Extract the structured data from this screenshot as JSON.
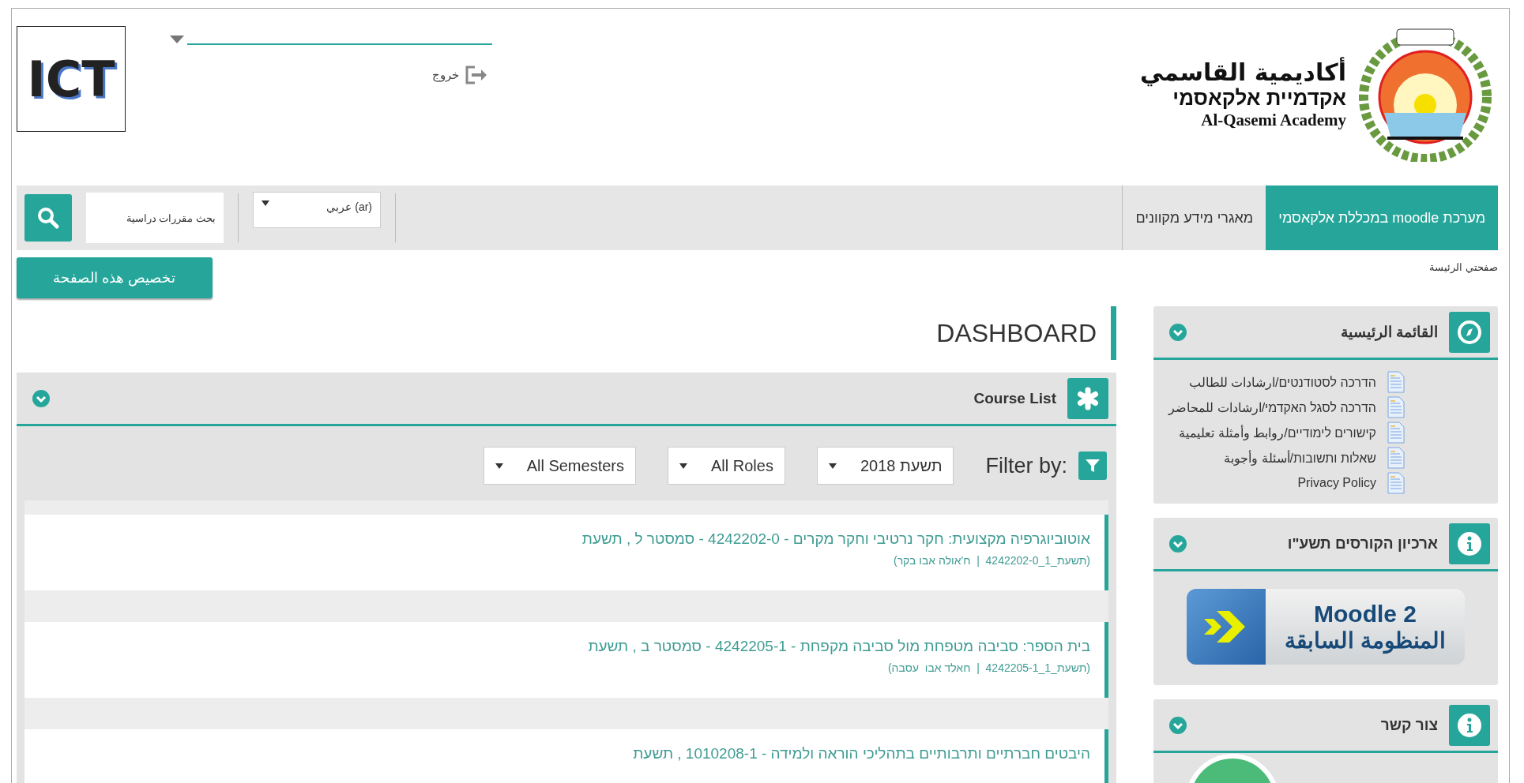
{
  "header": {
    "logo_text": "ICT",
    "logout": "خروج",
    "brand_ar": "أكاديمية القاسمي",
    "brand_he": "אקדמיית אלקאסמי",
    "brand_en": "Al-Qasemi Academy"
  },
  "nav": {
    "items": [
      {
        "label": "מערכת moodle במכללת אלקאסמי",
        "selected": true
      },
      {
        "label": "מאגרי מידע מקוונים",
        "selected": false
      }
    ],
    "language": "عربي (ar)",
    "search": {
      "placeholder": "بحث مقررات دراسية"
    }
  },
  "customize_button": "تخصيص هذه الصفحة",
  "breadcrumb": "صفحتي الرئيسة",
  "page_title": "DASHBOARD",
  "course_list": {
    "title": "Course List",
    "filter_label": "Filter by:",
    "filters": [
      "תשעת 2018",
      "All Roles",
      "All Semesters"
    ],
    "courses": [
      {
        "title": "אוטוביוגרפיה מקצועית: חקר נרטיבי וחקר מקרים - 4242202-0 - סמסטר ל , תשעת",
        "meta": "(תשעת_1_4242202-0  |  ח'אולה אבו בקר)"
      },
      {
        "title": "בית הספר: סביבה מטפחת מול סביבה מקפחת - 4242205-1 - סמסטר ב , תשעת",
        "meta": "(תשעת_1_4242205-1  |  חאלד אבו  עסבה)"
      },
      {
        "title": "היבטים חברתיים ותרבותיים בתהליכי הוראה ולמידה - 1010208-1 , תשעת"
      }
    ]
  },
  "sidebar": {
    "blocks": [
      {
        "kind": "menu",
        "title": "القائمة الرئيسية",
        "items": [
          "הדרכה לסטודנטים/ارشادات للطالب",
          "הדרכה לסגל האקדמי/ارشادات للمحاضر",
          "קישורים לימודיים/روابط وأمثلة تعليمية",
          "שאלות ותשובות/أسئلة وأجوبة",
          "Privacy Policy"
        ]
      },
      {
        "kind": "archive",
        "title": "ארכיון הקורסים תשע\"ו",
        "button_top": "Moodle 2",
        "button_bottom": "المنظومة السابقة"
      },
      {
        "kind": "contact",
        "title": "צור קשר"
      }
    ]
  }
}
